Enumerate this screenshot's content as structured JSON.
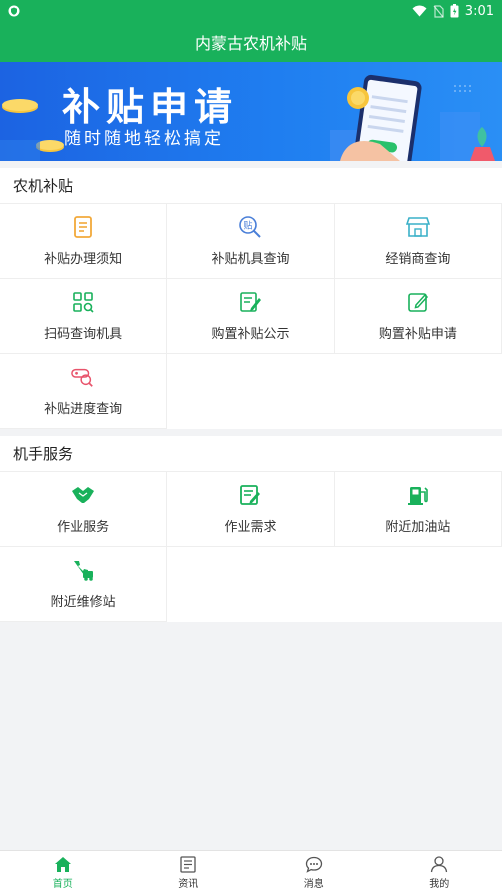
{
  "status_bar": {
    "time": "3:01"
  },
  "header": {
    "title": "内蒙古农机补贴"
  },
  "banner": {
    "title": "补贴申请",
    "subtitle": "随时随地轻松搞定"
  },
  "subsidy": {
    "title": "农机补贴",
    "items": [
      {
        "label": "补贴办理须知",
        "icon": "notice-icon"
      },
      {
        "label": "补贴机具查询",
        "icon": "subsidy-search-icon"
      },
      {
        "label": "经销商查询",
        "icon": "store-icon"
      },
      {
        "label": "扫码查询机具",
        "icon": "scan-icon"
      },
      {
        "label": "购置补贴公示",
        "icon": "publicity-icon"
      },
      {
        "label": "购置补贴申请",
        "icon": "apply-icon"
      },
      {
        "label": "补贴进度查询",
        "icon": "progress-icon"
      }
    ]
  },
  "driver": {
    "title": "机手服务",
    "items": [
      {
        "label": "作业服务",
        "icon": "handshake-icon"
      },
      {
        "label": "作业需求",
        "icon": "demand-icon"
      },
      {
        "label": "附近加油站",
        "icon": "gas-station-icon"
      },
      {
        "label": "附近维修站",
        "icon": "repair-icon"
      }
    ]
  },
  "tabbar": {
    "items": [
      {
        "label": "首页",
        "icon": "home-icon"
      },
      {
        "label": "资讯",
        "icon": "news-icon"
      },
      {
        "label": "消息",
        "icon": "message-icon"
      },
      {
        "label": "我的",
        "icon": "profile-icon"
      }
    ]
  },
  "colors": {
    "brand": "#19b15b",
    "accent_orange": "#f2a93b",
    "accent_blue": "#4a7fd8",
    "accent_red": "#e8536b"
  }
}
